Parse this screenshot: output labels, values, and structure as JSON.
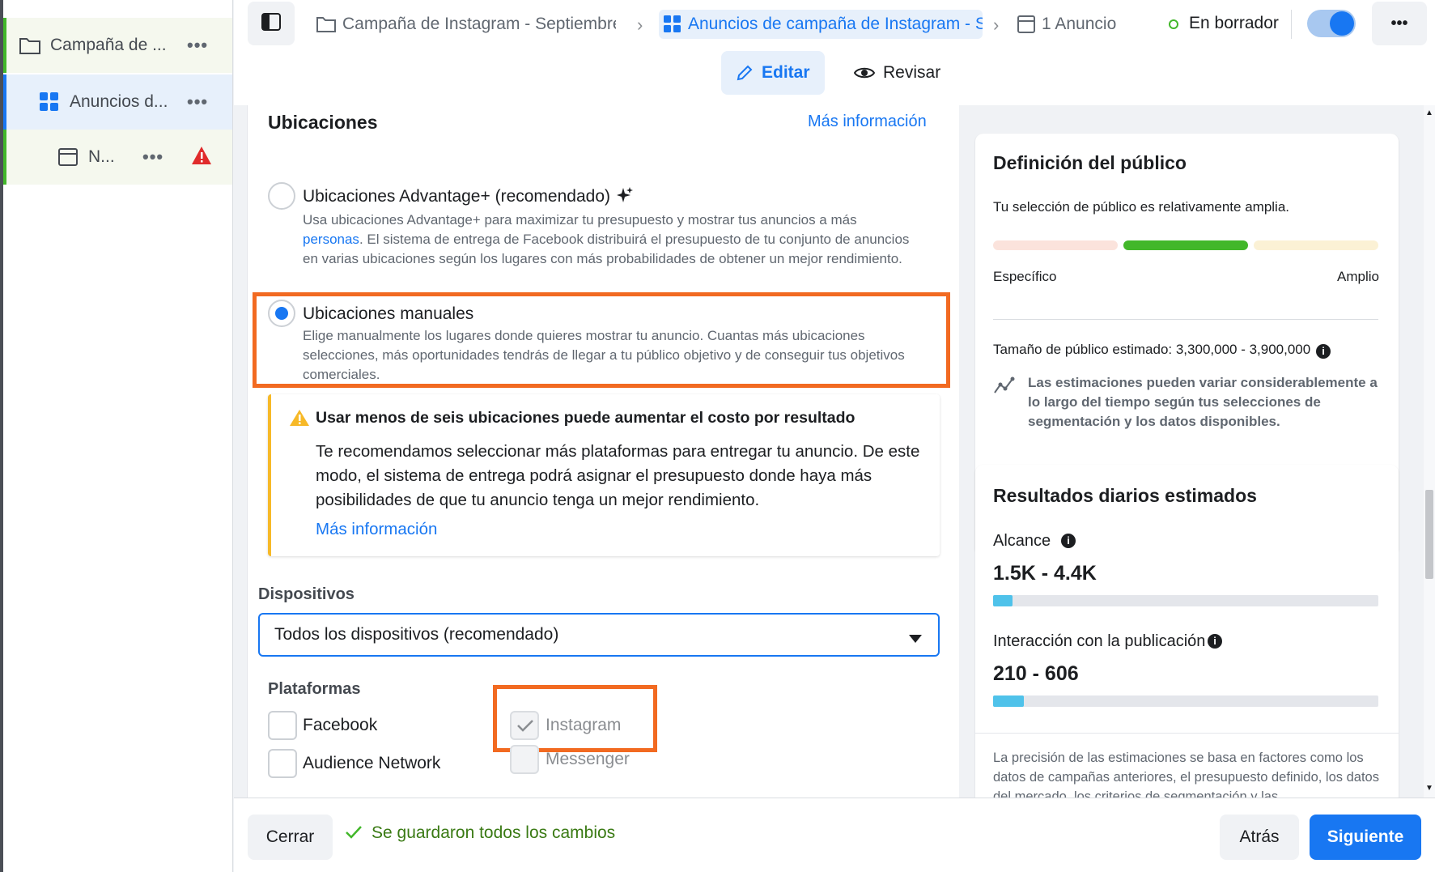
{
  "tree": {
    "items": [
      {
        "label": "Campaña de ...",
        "icon": "folder-icon",
        "accent": "#42b72a",
        "bg": "#f5f8ee"
      },
      {
        "label": "Anuncios d...",
        "icon": "grid-icon",
        "accent": "#1877f2",
        "bg": "#e7f0fb"
      },
      {
        "label": "N...",
        "icon": "ad-icon",
        "accent": "#42b72a",
        "bg": "#f5f8ee"
      }
    ],
    "more": "•••"
  },
  "header": {
    "breadcrumbs": [
      {
        "label": "Campaña de Instagram - Septiembre",
        "icon": "folder-icon"
      },
      {
        "label": "Anuncios de campaña de Instagram - S",
        "icon": "grid-icon"
      },
      {
        "label": "1 Anuncio",
        "icon": "ad-icon"
      }
    ],
    "status": "En borrador",
    "more": "•••",
    "tabs": {
      "edit": "Editar",
      "review": "Revisar"
    }
  },
  "placements": {
    "title": "Ubicaciones",
    "more_info": "Más información",
    "advantage": {
      "title": "Ubicaciones Advantage+ (recomendado)",
      "desc_before": "Usa ubicaciones Advantage+ para maximizar tu presupuesto y mostrar tus anuncios a más",
      "desc_link": "personas",
      "desc_after": ". El sistema de entrega de Facebook distribuirá el presupuesto de tu conjunto de anuncios en varias ubicaciones según los lugares con más probabilidades de obtener un mejor rendimiento."
    },
    "manual": {
      "title": "Ubicaciones manuales",
      "desc": "Elige manualmente los lugares donde quieres mostrar tu anuncio. Cuantas más ubicaciones selecciones, más oportunidades tendrás de llegar a tu público objetivo y de conseguir tus objetivos comerciales."
    },
    "warning": {
      "title": "Usar menos de seis ubicaciones puede aumentar el costo por resultado",
      "body": "Te recomendamos seleccionar más plataformas para entregar tu anuncio. De este modo, el sistema de entrega podrá asignar el presupuesto donde haya más posibilidades de que tu anuncio tenga un mejor rendimiento.",
      "link": "Más información"
    },
    "devices": {
      "label": "Dispositivos",
      "value": "Todos los dispositivos (recomendado)"
    },
    "platforms": {
      "label": "Plataformas",
      "items": [
        {
          "label": "Facebook",
          "checked": false,
          "disabled": false
        },
        {
          "label": "Audience Network",
          "checked": false,
          "disabled": false
        },
        {
          "label": "Instagram",
          "checked": true,
          "disabled": true
        },
        {
          "label": "Messenger",
          "checked": false,
          "disabled": true
        }
      ]
    }
  },
  "audience": {
    "title": "Definición del público",
    "summary": "Tu selección de público es relativamente amplia.",
    "specific": "Específico",
    "broad": "Amplio",
    "size": "Tamaño de público estimado: 3,300,000 - 3,900,000",
    "note": "Las estimaciones pueden variar considerablemente a lo largo del tiempo según tus selecciones de segmentación y los datos disponibles."
  },
  "results": {
    "title": "Resultados diarios estimados",
    "reach_label": "Alcance",
    "reach_value": "1.5K - 4.4K",
    "reach_fill": 0.05,
    "engagement_label": "Interacción con la publicación",
    "engagement_value": "210 - 606",
    "engagement_fill": 0.08,
    "footnote": "La precisión de las estimaciones se basa en factores como los datos de campañas anteriores, el presupuesto definido, los datos del mercado, los criterios de segmentación y las"
  },
  "footer": {
    "close": "Cerrar",
    "saved": "Se guardaron todos los cambios",
    "back": "Atrás",
    "next": "Siguiente"
  },
  "colors": {
    "accent": "#1877f2",
    "highlight": "#f26a21",
    "warning": "#f7b928",
    "success": "#42b72a"
  }
}
